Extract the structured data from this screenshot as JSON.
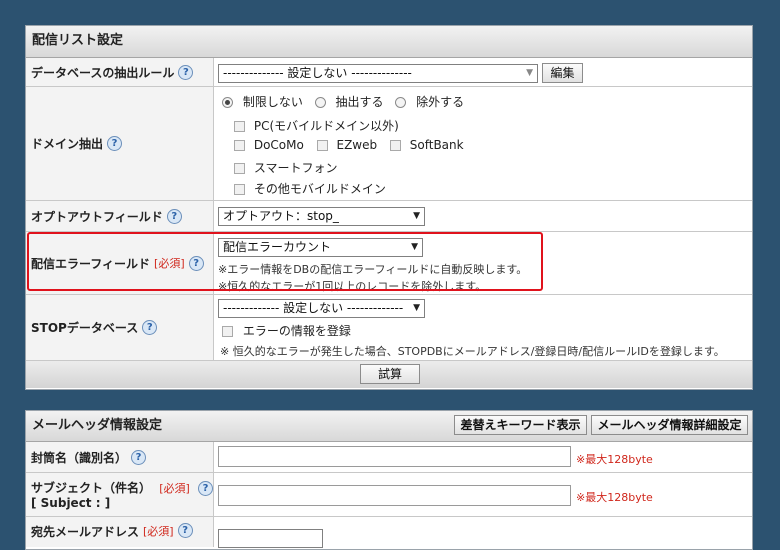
{
  "list_settings": {
    "title": "配信リスト設定",
    "extract_rule": {
      "label": "データベースの抽出ルール",
      "selected": "-------------- 設定しない --------------",
      "edit_button": "編集"
    },
    "domain": {
      "label": "ドメイン抽出",
      "radios": [
        "制限しない",
        "抽出する",
        "除外する"
      ],
      "radio_selected": "制限しない",
      "checks": {
        "pc": "PC(モバイルドメイン以外)",
        "docomo": "DoCoMo",
        "ezweb": "EZweb",
        "softbank": "SoftBank",
        "smartphone": "スマートフォン",
        "other": "その他モバイルドメイン"
      }
    },
    "optout": {
      "label": "オプトアウトフィールド",
      "selected": "オプトアウト：stop_"
    },
    "error_field": {
      "label": "配信エラーフィールド",
      "required": "[必須]",
      "selected": "配信エラーカウント",
      "note1": "※エラー情報をDBの配信エラーフィールドに自動反映します。",
      "note2": "※恒久的なエラーが1回以上のレコードを除外します。"
    },
    "stop_db": {
      "label": "STOPデータベース",
      "selected": "------------- 設定しない -------------",
      "check_label": "エラーの情報を登録",
      "note": "※ 恒久的なエラーが発生した場合、STOPDBにメールアドレス/登録日時/配信ルールIDを登録します。"
    },
    "trial_button": "試算"
  },
  "mail_header": {
    "title": "メールヘッダ情報設定",
    "keyword_button": "差替えキーワード表示",
    "detail_button": "メールヘッダ情報詳細設定",
    "envelope": {
      "label": "封筒名（識別名）",
      "max": "※最大128byte",
      "value": ""
    },
    "subject": {
      "label": "サブジェクト（件名）",
      "label2": "[ Subject : ]",
      "required": "[必須]",
      "max": "※最大128byte",
      "value": ""
    },
    "to": {
      "label": "宛先メールアドレス",
      "required": "[必須]"
    }
  },
  "help_symbol": "?"
}
